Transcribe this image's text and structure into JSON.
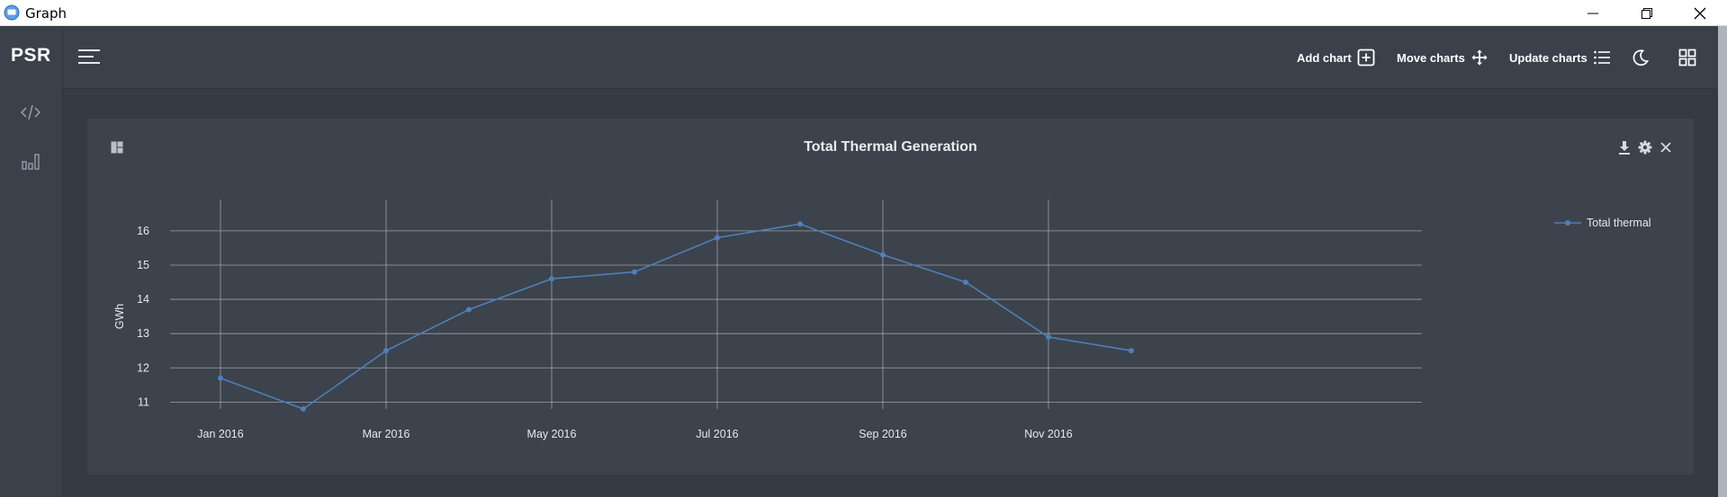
{
  "window": {
    "title": "Graph"
  },
  "sidebar": {
    "brand": "PSR",
    "items": [
      {
        "icon": "code-icon"
      },
      {
        "icon": "bar-chart-icon"
      }
    ]
  },
  "topbar": {
    "actions": [
      {
        "label": "Add chart",
        "icon": "plus-square-icon"
      },
      {
        "label": "Move charts",
        "icon": "move-arrows-icon"
      },
      {
        "label": "Update charts",
        "icon": "list-icon"
      }
    ],
    "icons": [
      "moon-icon",
      "grid-icon"
    ]
  },
  "card": {
    "title": "Total Thermal Generation",
    "tools": [
      "download-icon",
      "gear-icon",
      "close-icon"
    ]
  },
  "chart_data": {
    "type": "line",
    "title": "Total Thermal Generation",
    "ylabel": "GWh",
    "xlabel": "",
    "ylim": [
      10.8,
      16.6
    ],
    "x": [
      "2016-01",
      "2016-02",
      "2016-03",
      "2016-04",
      "2016-05",
      "2016-06",
      "2016-07",
      "2016-08",
      "2016-09",
      "2016-10",
      "2016-11",
      "2016-12"
    ],
    "x_tick_labels": [
      "Jan 2016",
      "Mar 2016",
      "May 2016",
      "Jul 2016",
      "Sep 2016",
      "Nov 2016"
    ],
    "y_ticks": [
      11,
      12,
      13,
      14,
      15,
      16
    ],
    "grid": true,
    "legend": "top-right",
    "series": [
      {
        "name": "Total thermal",
        "color": "#4f7fb8",
        "values": [
          11.7,
          10.8,
          12.5,
          13.7,
          14.6,
          14.8,
          15.8,
          16.2,
          15.3,
          14.5,
          12.9,
          12.5
        ]
      }
    ]
  }
}
